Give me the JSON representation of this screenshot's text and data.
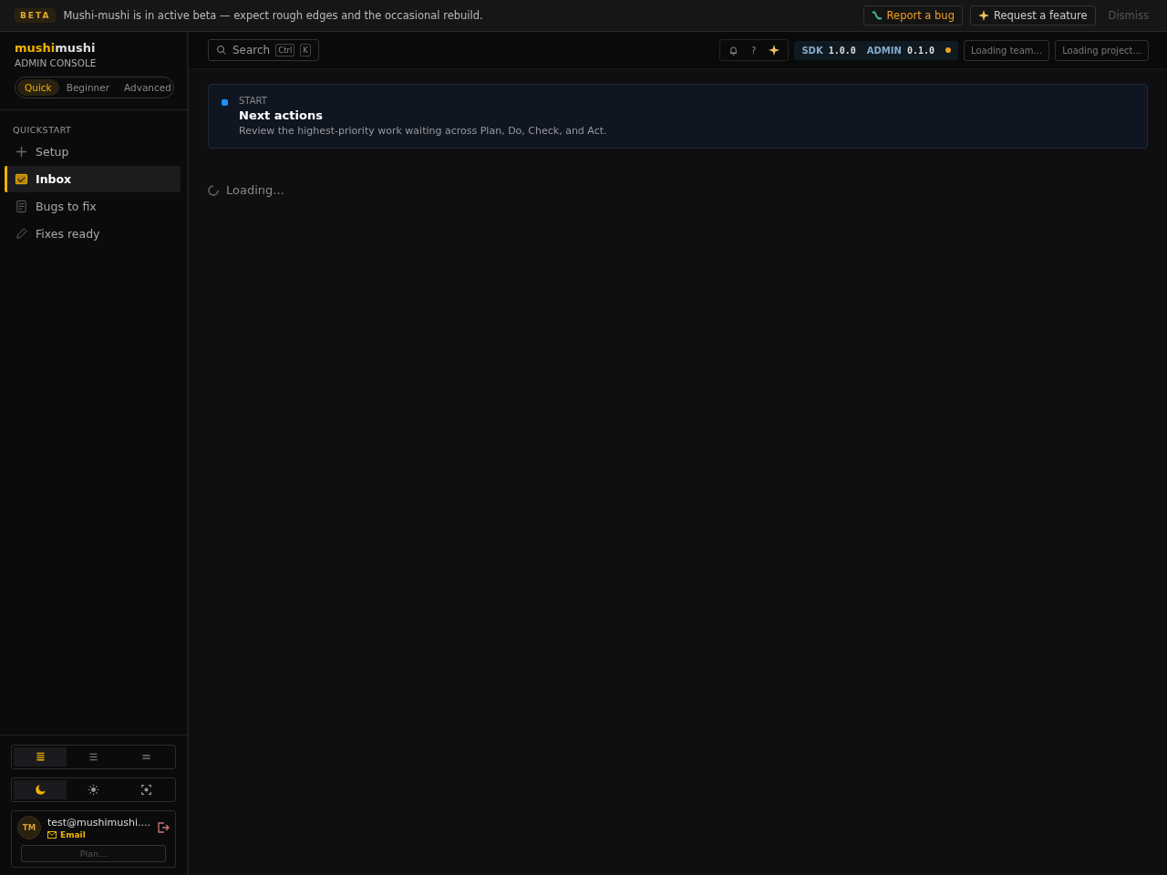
{
  "banner": {
    "badge": "BETA",
    "message": "Mushi-mushi is in active beta — expect rough edges and the occasional rebuild.",
    "actions": [
      {
        "label": "Report a bug",
        "kind": "bug"
      },
      {
        "label": "Request a feature",
        "kind": "feature"
      }
    ],
    "dismiss": "Dismiss"
  },
  "sidebar": {
    "brand_accent": "mushi",
    "brand_rest": "mushi",
    "subtitle": "ADMIN CONSOLE",
    "modes": [
      {
        "label": "Quick",
        "selected": true
      },
      {
        "label": "Beginner",
        "selected": false
      },
      {
        "label": "Advanced",
        "selected": false
      }
    ],
    "section": "QUICKSTART",
    "items": [
      {
        "label": "Setup",
        "kind": "plus",
        "selected": false
      },
      {
        "label": "Inbox",
        "kind": "inbox",
        "selected": true
      },
      {
        "label": "Bugs to fix",
        "kind": "doc",
        "selected": false
      },
      {
        "label": "Fixes ready",
        "kind": "pencil",
        "selected": false
      }
    ],
    "density": [
      {
        "kind": "dense",
        "selected": true
      },
      {
        "kind": "normal",
        "selected": false
      },
      {
        "kind": "loose",
        "selected": false
      }
    ],
    "theme": [
      {
        "kind": "dark",
        "selected": true
      },
      {
        "kind": "light",
        "selected": false
      },
      {
        "kind": "system",
        "selected": false
      }
    ],
    "user": {
      "initials": "TM",
      "email": "test@mushimushi....",
      "auth": "Email",
      "plan": "Plan..."
    }
  },
  "topbar": {
    "search": {
      "placeholder": "Search",
      "keys": [
        "Ctrl",
        "K"
      ]
    },
    "help": "?",
    "versions": [
      {
        "name": "SDK",
        "value": "1.0.0"
      },
      {
        "name": "ADMIN",
        "value": "0.1.0"
      }
    ],
    "team": "Loading team...",
    "project": "Loading project..."
  },
  "card": {
    "eyebrow": "START",
    "title": "Next actions",
    "description": "Review the highest-priority work waiting across Plan, Do, Check, and Act."
  },
  "loading": "Loading..."
}
